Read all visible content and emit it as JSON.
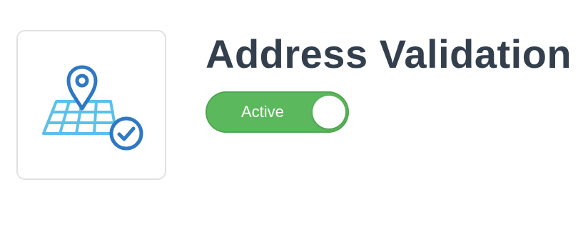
{
  "integration": {
    "title": "Address Validation",
    "icon": "map-pin-check-icon",
    "status": {
      "label": "Active",
      "enabled": true
    }
  },
  "colors": {
    "title": "#333f4d",
    "toggle_on": "#5cb85c",
    "icon_grid": "#5bc0eb",
    "icon_dark": "#2f78c4"
  }
}
